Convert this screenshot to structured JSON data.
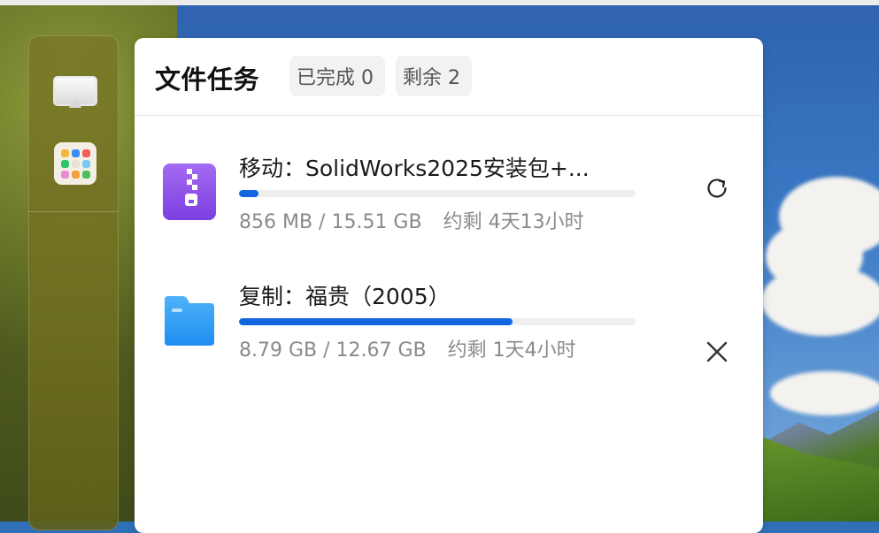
{
  "panel": {
    "title": "文件任务",
    "chips": {
      "done": "已完成 0",
      "remaining": "剩余 2"
    }
  },
  "tasks": [
    {
      "name": "移动：SolidWorks2025安装包+...",
      "progress": 0.05,
      "size": "856 MB / 15.51 GB",
      "eta": "约剩 4天13小时",
      "icon": "zip-archive-icon",
      "action": "refresh-icon"
    },
    {
      "name": "复制：福贵（2005）",
      "progress": 0.69,
      "size": "8.79 GB / 12.67 GB",
      "eta": "约剩 1天4小时",
      "icon": "folder-icon",
      "action": "close-icon"
    }
  ],
  "dock": {
    "items": [
      "monitor-icon",
      "app-grid-icon"
    ]
  },
  "colors": {
    "accent": "#1466e0",
    "zip_purple": "#8b4fe6",
    "folder_blue": "#2f9cf5"
  }
}
